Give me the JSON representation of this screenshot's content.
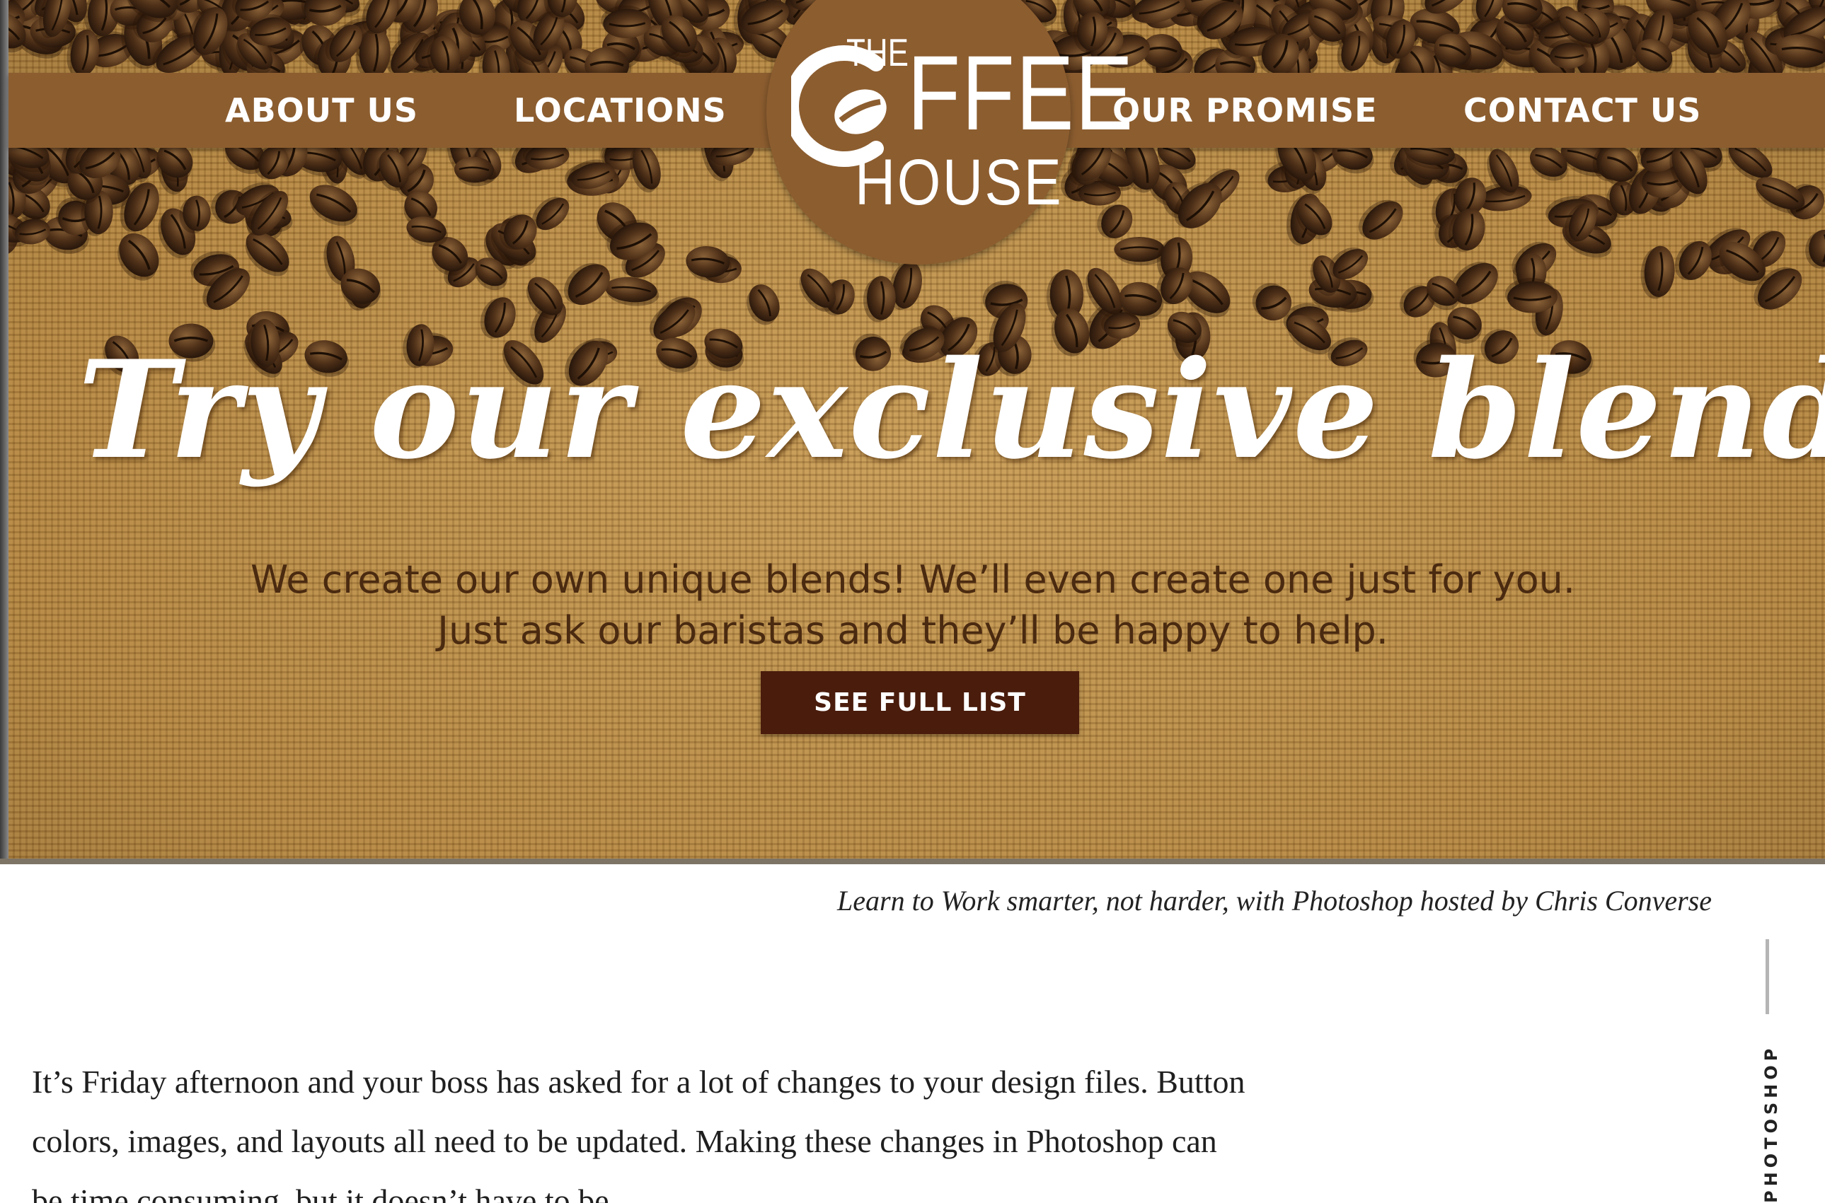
{
  "hero": {
    "nav": {
      "about": "ABOUT US",
      "locations": "LOCATIONS",
      "promise": "OUR PROMISE",
      "contact": "CONTACT US"
    },
    "logo": {
      "the": "THE",
      "ffee": "FFEE",
      "house": "HOUSE"
    },
    "headline": "Try our exclusive blends",
    "subtext_line1": "We create our own unique blends!  We’ll even create one just for you.",
    "subtext_line2": "Just ask our baristas and they’ll be happy to help.",
    "cta_label": "SEE FULL LIST",
    "colors": {
      "nav_bar": "#8c5d2f",
      "cta": "#4a1c0c",
      "burlap": "#b88a48",
      "subtext": "#4a2a10"
    }
  },
  "article": {
    "caption": "Learn to Work smarter, not harder, with Photoshop hosted by Chris Converse",
    "category_tag": "PHOTOSHOP",
    "body_lines": [
      "It’s Friday afternoon and your boss has asked for a lot of changes to your design files. Button",
      "colors, images, and layouts all need to be updated. Making these changes in Photoshop can",
      "be time consuming, but it doesn’t have to be."
    ]
  }
}
